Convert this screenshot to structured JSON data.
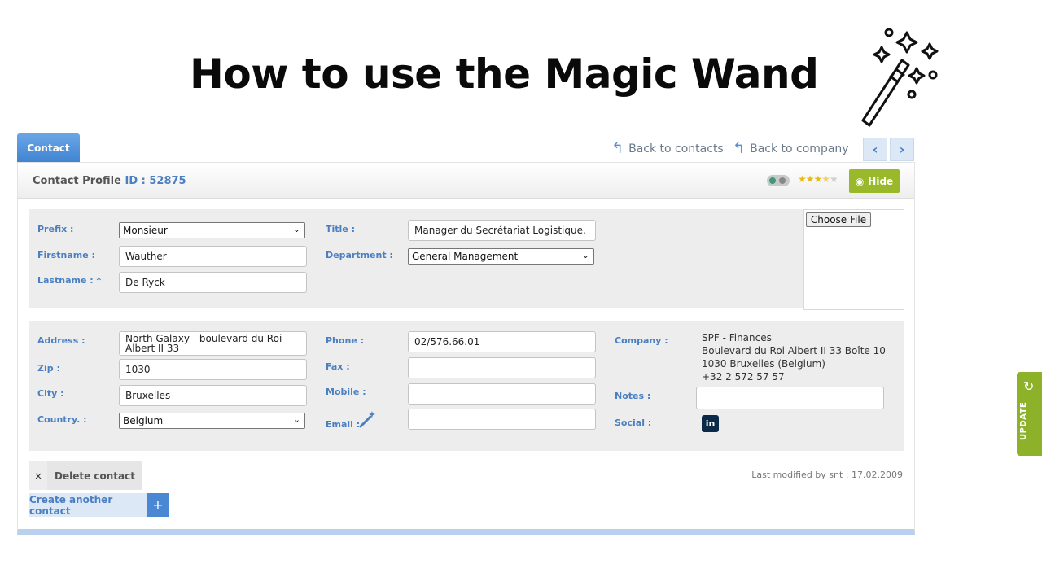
{
  "headline": "How to use the Magic Wand",
  "tab": "Contact",
  "links": {
    "back_contacts": "Back to contacts",
    "back_company": "Back to company",
    "prev": "‹",
    "next": "›"
  },
  "header": {
    "title": "Contact Profile",
    "id_label": "ID :",
    "id_value": "52875",
    "rating": 3.5,
    "hide_label": "Hide"
  },
  "identity": {
    "prefix_label": "Prefix :",
    "prefix_value": "Monsieur",
    "firstname_label": "Firstname :",
    "firstname_value": "Wauther",
    "lastname_label": "Lastname : *",
    "lastname_value": "De Ryck",
    "title_label": "Title :",
    "title_value": "Manager du Secrétariat  Logistique.",
    "department_label": "Department :",
    "department_value": "General Management",
    "choose_file": "Choose File"
  },
  "contact": {
    "address_label": "Address :",
    "address_value": "North Galaxy - boulevard du Roi Albert II 33",
    "zip_label": "Zip :",
    "zip_value": "1030",
    "city_label": "City :",
    "city_value": "Bruxelles",
    "country_label": "Country. :",
    "country_value": "Belgium",
    "phone_label": "Phone :",
    "phone_value": "02/576.66.01",
    "fax_label": "Fax :",
    "fax_value": "",
    "mobile_label": "Mobile :",
    "mobile_value": "",
    "email_label": "Email :",
    "email_value": "",
    "company_label": "Company :",
    "company_lines": [
      "SPF - Finances",
      "Boulevard du Roi Albert II 33 Boîte 10",
      "1030 Bruxelles (Belgium)",
      "+32 2 572 57 57"
    ],
    "notes_label": "Notes :",
    "notes_value": "",
    "social_label": "Social :",
    "linkedin_text": "in"
  },
  "footer": {
    "x": "×",
    "delete": "Delete contact",
    "create": "Create another contact",
    "plus": "+",
    "last_modified": "Last modified by snt : 17.02.2009"
  },
  "update_tab": {
    "label": "UPDATE",
    "icon": "↻"
  },
  "colors": {
    "accent": "#4a7fc1",
    "green": "#9ab92a",
    "update_green": "#8eb12a"
  }
}
